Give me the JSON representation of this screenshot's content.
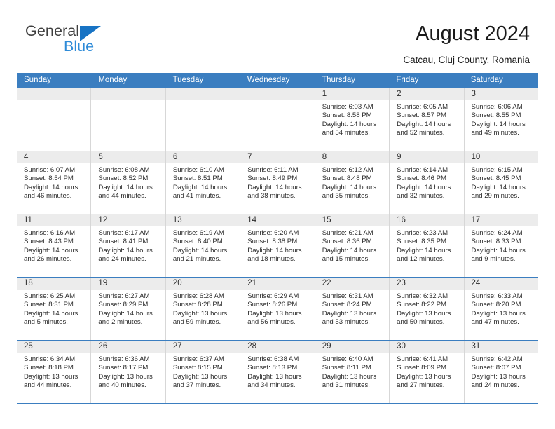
{
  "brand": {
    "name_part1": "General",
    "name_part2": "Blue",
    "triangle_color": "#1773c4",
    "blue_color": "#2e8bd8"
  },
  "header": {
    "title": "August 2024",
    "subtitle": "Catcau, Cluj County, Romania"
  },
  "theme": {
    "header_blue": "#3b7ec0",
    "day_band_gray": "#ececec",
    "grid_line": "#d7d7d7"
  },
  "weekdays": [
    "Sunday",
    "Monday",
    "Tuesday",
    "Wednesday",
    "Thursday",
    "Friday",
    "Saturday"
  ],
  "weeks": [
    [
      {
        "day": "",
        "sunrise": "",
        "sunset": "",
        "daylight_line1": "",
        "daylight_line2": ""
      },
      {
        "day": "",
        "sunrise": "",
        "sunset": "",
        "daylight_line1": "",
        "daylight_line2": ""
      },
      {
        "day": "",
        "sunrise": "",
        "sunset": "",
        "daylight_line1": "",
        "daylight_line2": ""
      },
      {
        "day": "",
        "sunrise": "",
        "sunset": "",
        "daylight_line1": "",
        "daylight_line2": ""
      },
      {
        "day": "1",
        "sunrise": "Sunrise: 6:03 AM",
        "sunset": "Sunset: 8:58 PM",
        "daylight_line1": "Daylight: 14 hours",
        "daylight_line2": "and 54 minutes."
      },
      {
        "day": "2",
        "sunrise": "Sunrise: 6:05 AM",
        "sunset": "Sunset: 8:57 PM",
        "daylight_line1": "Daylight: 14 hours",
        "daylight_line2": "and 52 minutes."
      },
      {
        "day": "3",
        "sunrise": "Sunrise: 6:06 AM",
        "sunset": "Sunset: 8:55 PM",
        "daylight_line1": "Daylight: 14 hours",
        "daylight_line2": "and 49 minutes."
      }
    ],
    [
      {
        "day": "4",
        "sunrise": "Sunrise: 6:07 AM",
        "sunset": "Sunset: 8:54 PM",
        "daylight_line1": "Daylight: 14 hours",
        "daylight_line2": "and 46 minutes."
      },
      {
        "day": "5",
        "sunrise": "Sunrise: 6:08 AM",
        "sunset": "Sunset: 8:52 PM",
        "daylight_line1": "Daylight: 14 hours",
        "daylight_line2": "and 44 minutes."
      },
      {
        "day": "6",
        "sunrise": "Sunrise: 6:10 AM",
        "sunset": "Sunset: 8:51 PM",
        "daylight_line1": "Daylight: 14 hours",
        "daylight_line2": "and 41 minutes."
      },
      {
        "day": "7",
        "sunrise": "Sunrise: 6:11 AM",
        "sunset": "Sunset: 8:49 PM",
        "daylight_line1": "Daylight: 14 hours",
        "daylight_line2": "and 38 minutes."
      },
      {
        "day": "8",
        "sunrise": "Sunrise: 6:12 AM",
        "sunset": "Sunset: 8:48 PM",
        "daylight_line1": "Daylight: 14 hours",
        "daylight_line2": "and 35 minutes."
      },
      {
        "day": "9",
        "sunrise": "Sunrise: 6:14 AM",
        "sunset": "Sunset: 8:46 PM",
        "daylight_line1": "Daylight: 14 hours",
        "daylight_line2": "and 32 minutes."
      },
      {
        "day": "10",
        "sunrise": "Sunrise: 6:15 AM",
        "sunset": "Sunset: 8:45 PM",
        "daylight_line1": "Daylight: 14 hours",
        "daylight_line2": "and 29 minutes."
      }
    ],
    [
      {
        "day": "11",
        "sunrise": "Sunrise: 6:16 AM",
        "sunset": "Sunset: 8:43 PM",
        "daylight_line1": "Daylight: 14 hours",
        "daylight_line2": "and 26 minutes."
      },
      {
        "day": "12",
        "sunrise": "Sunrise: 6:17 AM",
        "sunset": "Sunset: 8:41 PM",
        "daylight_line1": "Daylight: 14 hours",
        "daylight_line2": "and 24 minutes."
      },
      {
        "day": "13",
        "sunrise": "Sunrise: 6:19 AM",
        "sunset": "Sunset: 8:40 PM",
        "daylight_line1": "Daylight: 14 hours",
        "daylight_line2": "and 21 minutes."
      },
      {
        "day": "14",
        "sunrise": "Sunrise: 6:20 AM",
        "sunset": "Sunset: 8:38 PM",
        "daylight_line1": "Daylight: 14 hours",
        "daylight_line2": "and 18 minutes."
      },
      {
        "day": "15",
        "sunrise": "Sunrise: 6:21 AM",
        "sunset": "Sunset: 8:36 PM",
        "daylight_line1": "Daylight: 14 hours",
        "daylight_line2": "and 15 minutes."
      },
      {
        "day": "16",
        "sunrise": "Sunrise: 6:23 AM",
        "sunset": "Sunset: 8:35 PM",
        "daylight_line1": "Daylight: 14 hours",
        "daylight_line2": "and 12 minutes."
      },
      {
        "day": "17",
        "sunrise": "Sunrise: 6:24 AM",
        "sunset": "Sunset: 8:33 PM",
        "daylight_line1": "Daylight: 14 hours",
        "daylight_line2": "and 9 minutes."
      }
    ],
    [
      {
        "day": "18",
        "sunrise": "Sunrise: 6:25 AM",
        "sunset": "Sunset: 8:31 PM",
        "daylight_line1": "Daylight: 14 hours",
        "daylight_line2": "and 5 minutes."
      },
      {
        "day": "19",
        "sunrise": "Sunrise: 6:27 AM",
        "sunset": "Sunset: 8:29 PM",
        "daylight_line1": "Daylight: 14 hours",
        "daylight_line2": "and 2 minutes."
      },
      {
        "day": "20",
        "sunrise": "Sunrise: 6:28 AM",
        "sunset": "Sunset: 8:28 PM",
        "daylight_line1": "Daylight: 13 hours",
        "daylight_line2": "and 59 minutes."
      },
      {
        "day": "21",
        "sunrise": "Sunrise: 6:29 AM",
        "sunset": "Sunset: 8:26 PM",
        "daylight_line1": "Daylight: 13 hours",
        "daylight_line2": "and 56 minutes."
      },
      {
        "day": "22",
        "sunrise": "Sunrise: 6:31 AM",
        "sunset": "Sunset: 8:24 PM",
        "daylight_line1": "Daylight: 13 hours",
        "daylight_line2": "and 53 minutes."
      },
      {
        "day": "23",
        "sunrise": "Sunrise: 6:32 AM",
        "sunset": "Sunset: 8:22 PM",
        "daylight_line1": "Daylight: 13 hours",
        "daylight_line2": "and 50 minutes."
      },
      {
        "day": "24",
        "sunrise": "Sunrise: 6:33 AM",
        "sunset": "Sunset: 8:20 PM",
        "daylight_line1": "Daylight: 13 hours",
        "daylight_line2": "and 47 minutes."
      }
    ],
    [
      {
        "day": "25",
        "sunrise": "Sunrise: 6:34 AM",
        "sunset": "Sunset: 8:18 PM",
        "daylight_line1": "Daylight: 13 hours",
        "daylight_line2": "and 44 minutes."
      },
      {
        "day": "26",
        "sunrise": "Sunrise: 6:36 AM",
        "sunset": "Sunset: 8:17 PM",
        "daylight_line1": "Daylight: 13 hours",
        "daylight_line2": "and 40 minutes."
      },
      {
        "day": "27",
        "sunrise": "Sunrise: 6:37 AM",
        "sunset": "Sunset: 8:15 PM",
        "daylight_line1": "Daylight: 13 hours",
        "daylight_line2": "and 37 minutes."
      },
      {
        "day": "28",
        "sunrise": "Sunrise: 6:38 AM",
        "sunset": "Sunset: 8:13 PM",
        "daylight_line1": "Daylight: 13 hours",
        "daylight_line2": "and 34 minutes."
      },
      {
        "day": "29",
        "sunrise": "Sunrise: 6:40 AM",
        "sunset": "Sunset: 8:11 PM",
        "daylight_line1": "Daylight: 13 hours",
        "daylight_line2": "and 31 minutes."
      },
      {
        "day": "30",
        "sunrise": "Sunrise: 6:41 AM",
        "sunset": "Sunset: 8:09 PM",
        "daylight_line1": "Daylight: 13 hours",
        "daylight_line2": "and 27 minutes."
      },
      {
        "day": "31",
        "sunrise": "Sunrise: 6:42 AM",
        "sunset": "Sunset: 8:07 PM",
        "daylight_line1": "Daylight: 13 hours",
        "daylight_line2": "and 24 minutes."
      }
    ]
  ]
}
